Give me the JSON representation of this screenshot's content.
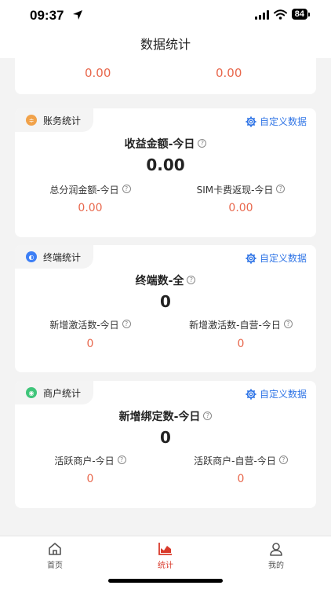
{
  "status_bar": {
    "time": "09:37",
    "battery": "84"
  },
  "nav": {
    "title": "数据统计"
  },
  "top_card": {
    "left_value": "0.00",
    "right_value": "0.00"
  },
  "finance": {
    "tag": "账务统计",
    "custom": "自定义数据",
    "main_label": "收益金额-今日",
    "main_value": "0.00",
    "left_label": "总分润金额-今日",
    "left_value": "0.00",
    "right_label": "SIM卡费返现-今日",
    "right_value": "0.00"
  },
  "terminal": {
    "tag": "终端统计",
    "custom": "自定义数据",
    "main_label": "终端数-全",
    "main_value": "0",
    "left_label": "新增激活数-今日",
    "left_value": "0",
    "right_label": "新增激活数-自营-今日",
    "right_value": "0"
  },
  "merchant": {
    "tag": "商户统计",
    "custom": "自定义数据",
    "main_label": "新增绑定数-今日",
    "main_value": "0",
    "left_label": "活跃商户-今日",
    "left_value": "0",
    "right_label": "活跃商户-自营-今日",
    "right_value": "0"
  },
  "tabs": [
    {
      "label": "首页",
      "icon": "home-icon"
    },
    {
      "label": "统计",
      "icon": "chart-icon"
    },
    {
      "label": "我的",
      "icon": "user-icon"
    }
  ],
  "colors": {
    "accent_red": "#d93a2b",
    "value_orange": "#e8674c",
    "link_blue": "#2f74e6"
  }
}
